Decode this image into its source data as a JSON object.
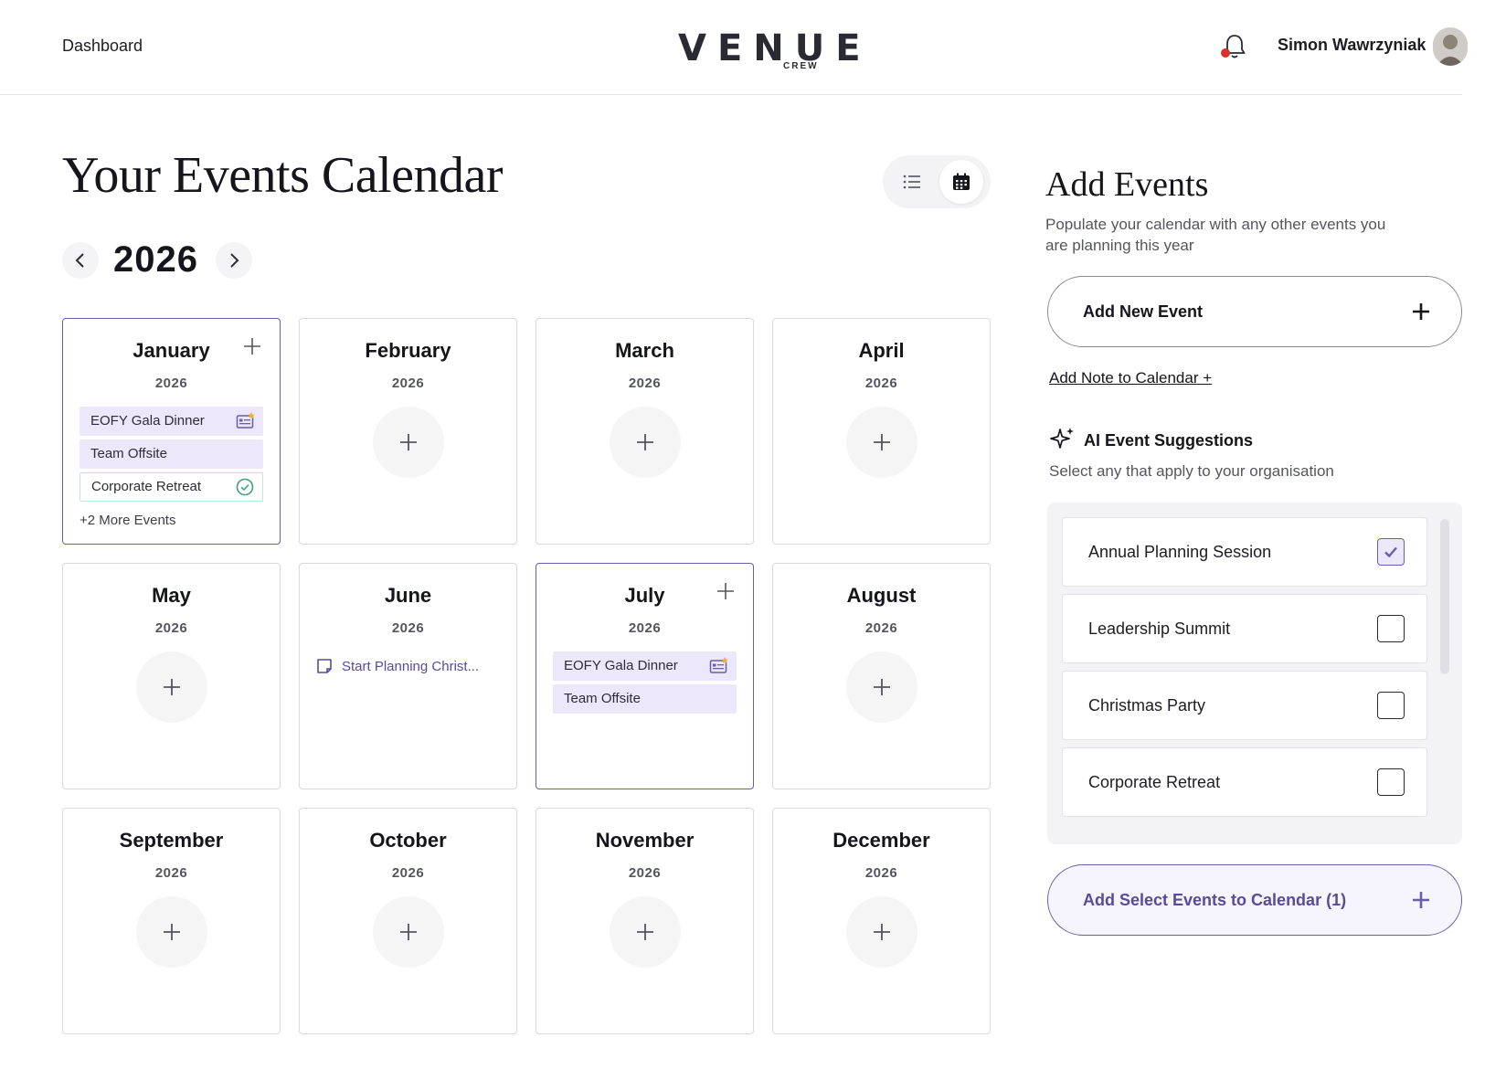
{
  "header": {
    "nav_label": "Dashboard",
    "logo_text": "VENUE",
    "logo_sub": "CREW",
    "user_name": "Simon Wawrzyniak"
  },
  "page": {
    "title": "Your Events Calendar",
    "year": "2026"
  },
  "colors": {
    "accent": "#6b5ea8",
    "event_bg": "#ece7fb",
    "confirmed_border": "#bfe8d6",
    "notification_dot": "#d9302c"
  },
  "months": [
    {
      "name": "January",
      "year": "2026",
      "events": [
        {
          "label": "EOFY Gala Dinner",
          "style": "purple",
          "icon": "ticket-star-icon"
        },
        {
          "label": "Team Offsite",
          "style": "purple"
        },
        {
          "label": "Corporate Retreat",
          "style": "green",
          "icon": "check-circle-icon"
        }
      ],
      "more": "+2 More Events"
    },
    {
      "name": "February",
      "year": "2026",
      "events": []
    },
    {
      "name": "March",
      "year": "2026",
      "events": []
    },
    {
      "name": "April",
      "year": "2026",
      "events": []
    },
    {
      "name": "May",
      "year": "2026",
      "events": []
    },
    {
      "name": "June",
      "year": "2026",
      "events": [],
      "note": "Start Planning Christ..."
    },
    {
      "name": "July",
      "year": "2026",
      "events": [
        {
          "label": "EOFY Gala Dinner",
          "style": "purple",
          "icon": "ticket-star-icon"
        },
        {
          "label": "Team Offsite",
          "style": "purple"
        }
      ]
    },
    {
      "name": "August",
      "year": "2026",
      "events": []
    },
    {
      "name": "September",
      "year": "2026",
      "events": []
    },
    {
      "name": "October",
      "year": "2026",
      "events": []
    },
    {
      "name": "November",
      "year": "2026",
      "events": []
    },
    {
      "name": "December",
      "year": "2026",
      "events": []
    }
  ],
  "side": {
    "title": "Add Events",
    "description": "Populate your calendar with any other events you are planning this year",
    "add_new_label": "Add New Event",
    "note_link": "Add Note to Calendar +",
    "ai_title": "AI Event Suggestions",
    "ai_description": "Select any that apply to your organisation",
    "suggestions": [
      {
        "label": "Annual Planning Session",
        "checked": true
      },
      {
        "label": "Leadership Summit",
        "checked": false
      },
      {
        "label": "Christmas Party",
        "checked": false
      },
      {
        "label": "Corporate Retreat",
        "checked": false
      }
    ],
    "add_selected_label": "Add Select Events to Calendar (1)"
  }
}
